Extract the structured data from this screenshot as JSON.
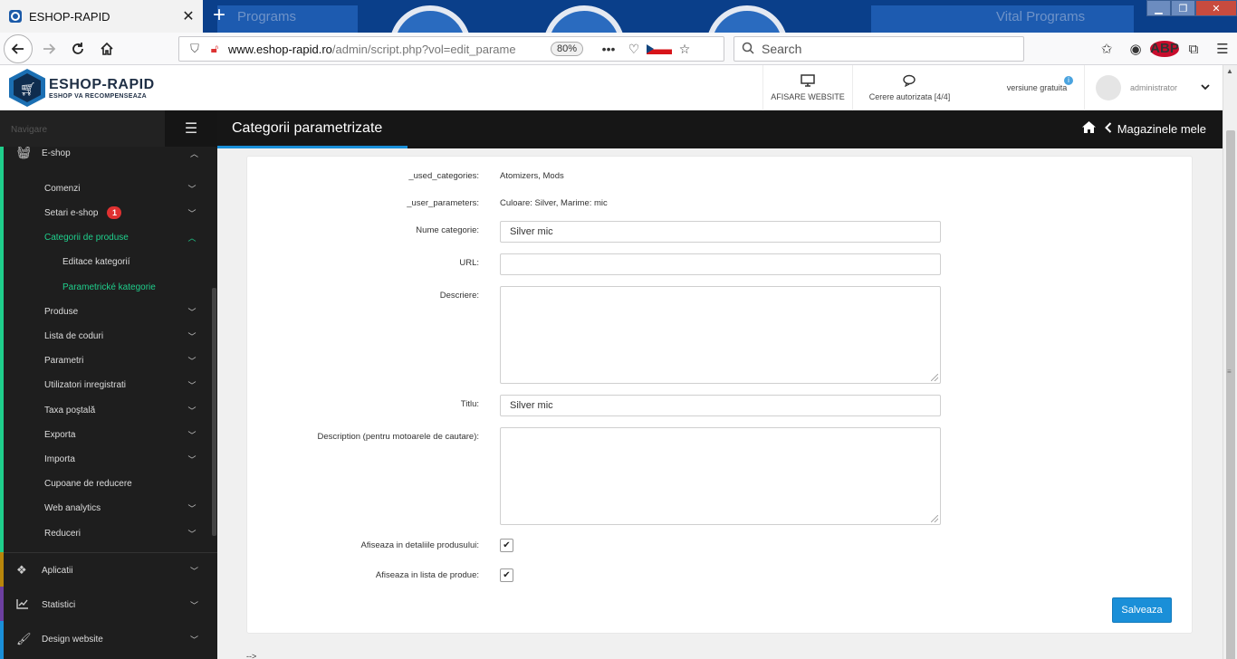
{
  "browser": {
    "tab_title": "ESHOP-RAPID",
    "tab_close": "✕",
    "new_tab": "+",
    "url_domain": "www.eshop-rapid.ro",
    "url_path": "/admin/script.php?vol=edit_parame",
    "zoom": "80%",
    "search_placeholder": "Search",
    "bg_text_1": "Programs",
    "bg_text_2": "Vital Programs"
  },
  "app": {
    "logo_name": "ESHOP-RAPID",
    "logo_tagline": "ESHOP VA RECOMPENSEAZA",
    "header": {
      "website_label": "AFISARE WEBSITE",
      "cerere_label": "Cerere autorizata [4/4]",
      "versiune_label": "versiune gratuita",
      "admin_label": "administrator"
    }
  },
  "sidebar": {
    "nav_label": "Navigare",
    "eshop_label": "E-shop",
    "items": [
      {
        "label": "Comenzi"
      },
      {
        "label": "Setari e-shop",
        "badge": "1"
      },
      {
        "label": "Categorii de produse"
      },
      {
        "label": "Produse"
      },
      {
        "label": "Lista de coduri"
      },
      {
        "label": "Parametri"
      },
      {
        "label": "Utilizatori inregistrati"
      },
      {
        "label": "Taxa poştală"
      },
      {
        "label": "Exporta"
      },
      {
        "label": "Importa"
      },
      {
        "label": "Cupoane de reducere"
      },
      {
        "label": "Web analytics"
      },
      {
        "label": "Reduceri"
      }
    ],
    "subitems": [
      {
        "label": "Editace kategorií"
      },
      {
        "label": "Parametrické kategorie"
      }
    ],
    "modules": [
      {
        "label": "Aplicatii"
      },
      {
        "label": "Statistici"
      },
      {
        "label": "Design website"
      }
    ]
  },
  "page": {
    "title": "Categorii parametrizate",
    "breadcrumb": "Magazinele mele"
  },
  "form": {
    "used_categories_label": "_used_categories:",
    "used_categories_value": "Atomizers, Mods",
    "user_parameters_label": "_user_parameters:",
    "user_parameters_value": "Culoare: Silver, Marime: mic",
    "nume_label": "Nume categorie:",
    "nume_value": "Silver mic",
    "url_label": "URL:",
    "url_value": "",
    "descriere_label": "Descriere:",
    "titlu_label": "Titlu:",
    "titlu_value": "Silver mic",
    "description_label": "Description (pentru motoarele de cautare):",
    "detail_label": "Afiseaza in detaliile produsului:",
    "list_label": "Afiseaza in lista de produe:",
    "check_mark": "✔",
    "save_label": "Salveaza",
    "tail_text": "-->"
  },
  "colors": {
    "accent": "#1a8fd8",
    "active_green": "#1fcf8c",
    "sidebar_bg": "#1e1e1e"
  }
}
